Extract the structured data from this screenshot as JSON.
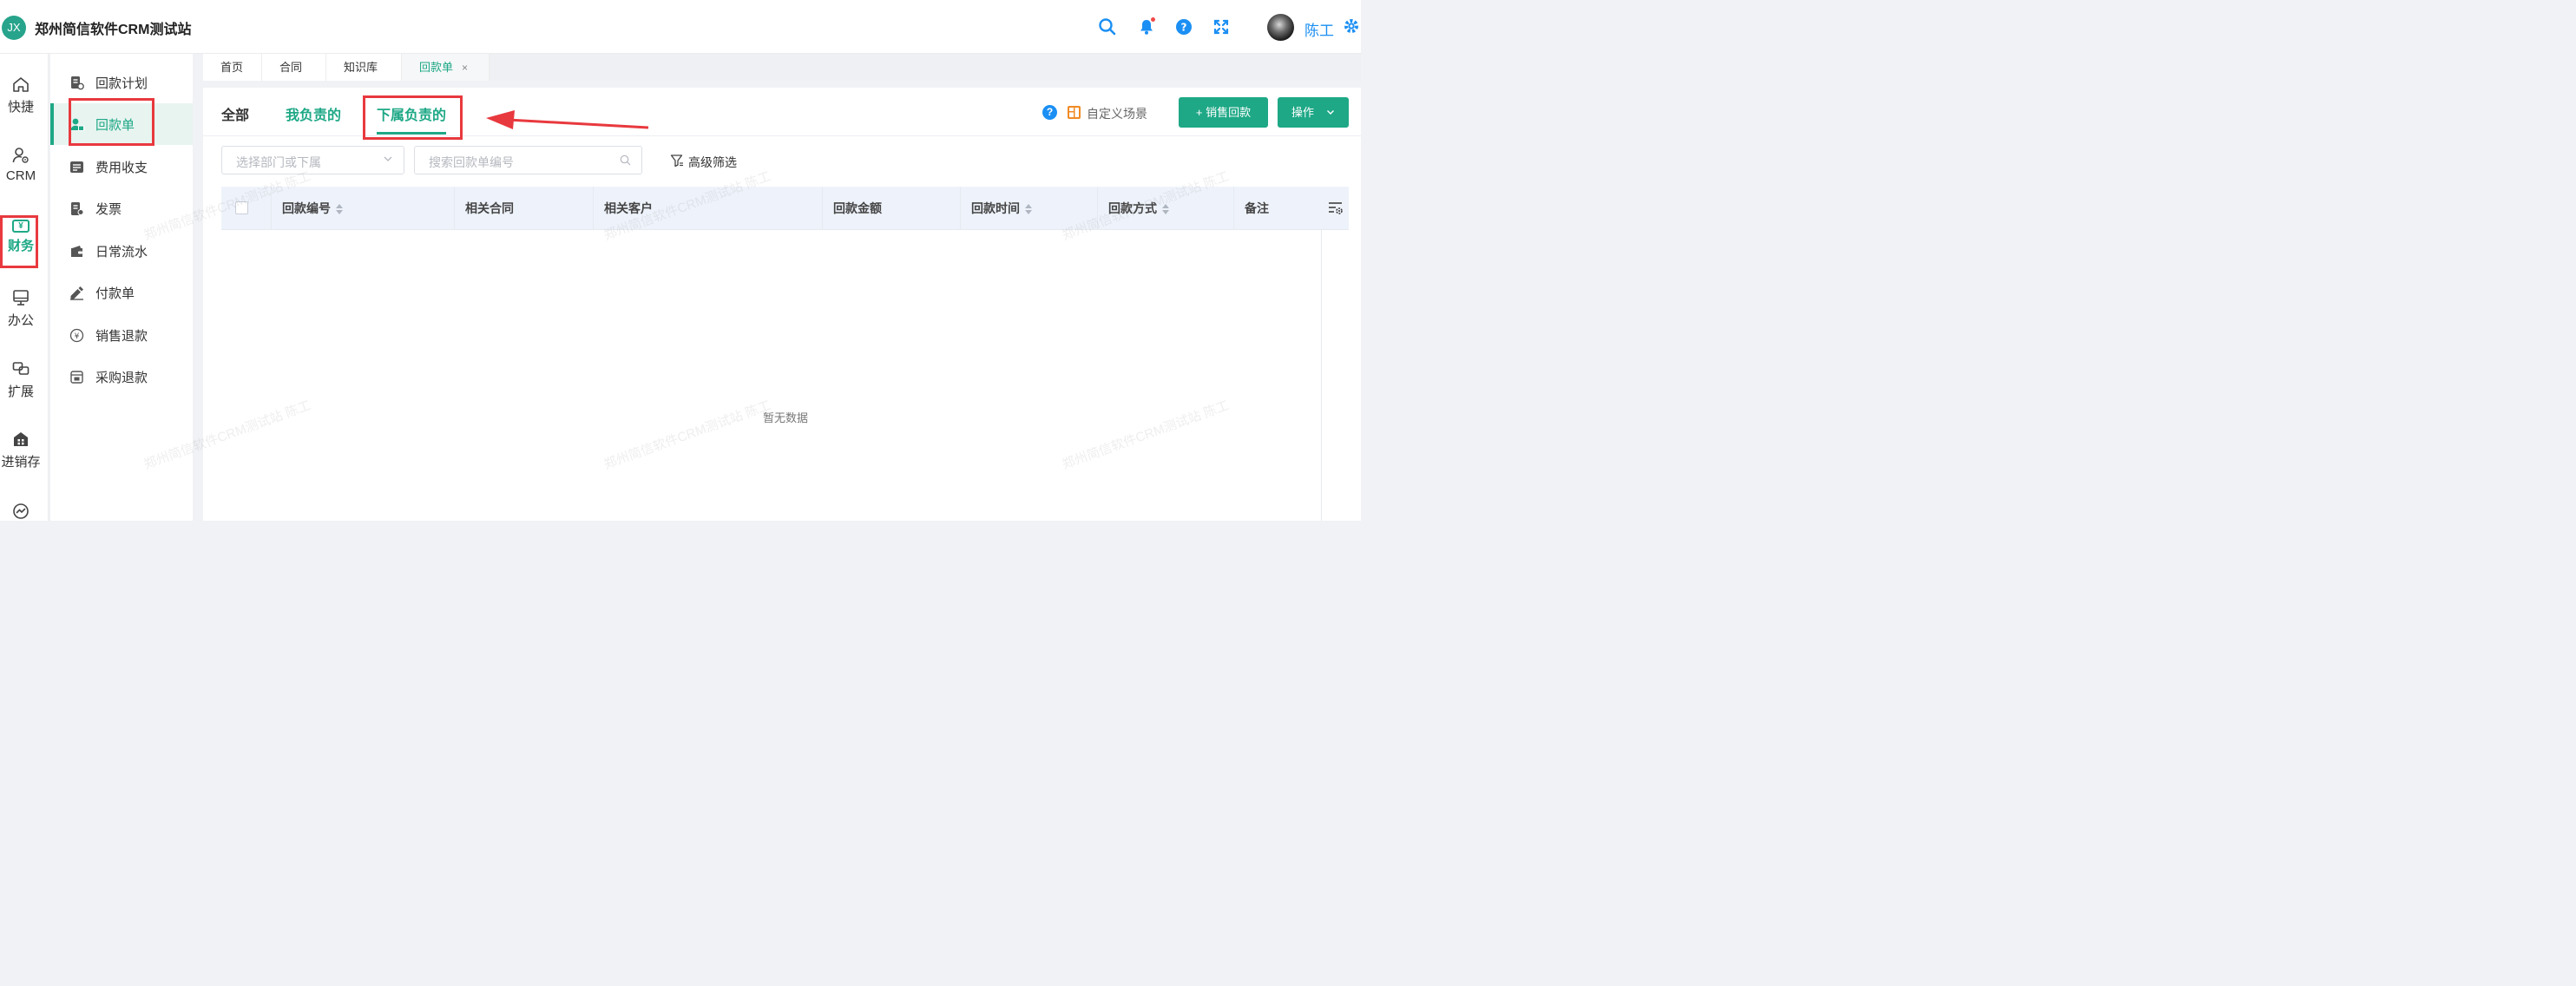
{
  "header": {
    "logo_text": "JX",
    "app_title": "郑州简信软件CRM测试站",
    "user_name": "陈工"
  },
  "rail": [
    {
      "label": "快捷",
      "icon": "home-icon"
    },
    {
      "label": "CRM",
      "icon": "user-gear-icon"
    },
    {
      "label": "财务",
      "icon": "money-icon",
      "badge": "¥"
    },
    {
      "label": "办公",
      "icon": "monitor-icon"
    },
    {
      "label": "扩展",
      "icon": "extension-icon"
    },
    {
      "label": "进销存",
      "icon": "store-icon"
    }
  ],
  "submenu": [
    {
      "label": "回款计划",
      "icon": "plan-icon"
    },
    {
      "label": "回款单",
      "icon": "receipt-icon",
      "active": true
    },
    {
      "label": "费用收支",
      "icon": "expense-icon"
    },
    {
      "label": "发票",
      "icon": "invoice-icon"
    },
    {
      "label": "日常流水",
      "icon": "wallet-icon"
    },
    {
      "label": "付款单",
      "icon": "payment-icon"
    },
    {
      "label": "销售退款",
      "icon": "refund-icon"
    },
    {
      "label": "采购退款",
      "icon": "purchase-refund-icon"
    }
  ],
  "tabs": [
    {
      "label": "首页"
    },
    {
      "label": "合同"
    },
    {
      "label": "知识库"
    },
    {
      "label": "回款单",
      "active": true,
      "close": "×"
    }
  ],
  "scenes": {
    "all": "全部",
    "mine": "我负责的",
    "subordinate": "下属负责的"
  },
  "toolbar": {
    "custom_scene": "自定义场景",
    "add_button": "+ 销售回款",
    "ops_button": "操作"
  },
  "filters": {
    "dept_placeholder": "选择部门或下属",
    "search_placeholder": "搜索回款单编号",
    "advanced": "高级筛选"
  },
  "table": {
    "columns": [
      "回款编号",
      "相关合同",
      "相关客户",
      "回款金额",
      "回款时间",
      "回款方式",
      "备注"
    ],
    "empty_text": "暂无数据"
  },
  "watermark": "郑州简信软件CRM测试站 陈工",
  "colors": {
    "brand": "#1ea886",
    "link": "#1b8ff3",
    "highlight": "#e8393e"
  }
}
